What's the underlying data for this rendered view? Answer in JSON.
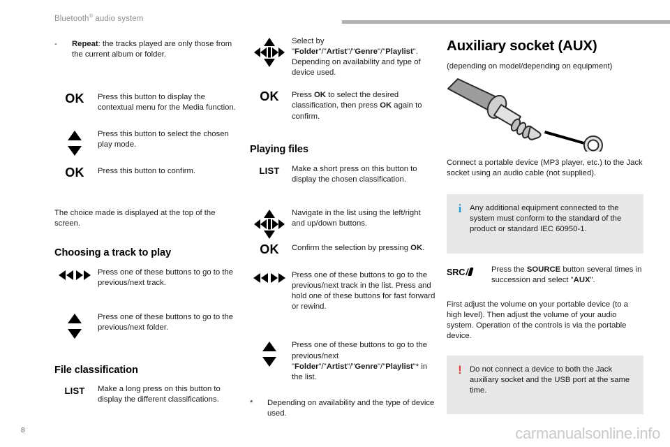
{
  "header": {
    "title_main": "Bluetooth",
    "title_sup": "®",
    "title_rest": " audio system"
  },
  "footer": {
    "page_number": "8",
    "watermark": "carmanualsonline.info"
  },
  "left_column": {
    "bullet": {
      "dash": "-",
      "bold_lead": "Repeat",
      "text": ": the tracks played are only those from the current album or folder."
    },
    "rows": [
      {
        "icon": "ok-button-label",
        "label": "OK",
        "text": "Press this button to display the contextual menu for the Media function."
      },
      {
        "icon": "up-down-arrows-icon",
        "label": "",
        "text": "Press this button to select the chosen play mode."
      },
      {
        "icon": "ok-button-label",
        "label": "OK",
        "text": "Press this button to confirm."
      }
    ],
    "note": "The choice made is displayed at the top of the screen.",
    "heading_track": "Choosing a track to play",
    "rows_track": [
      {
        "icon": "prev-next-arrows-icon",
        "label": "",
        "text": "Press one of these buttons to go to the previous/next track."
      },
      {
        "icon": "up-down-arrows-icon",
        "label": "",
        "text": "Press one of these buttons to go to the previous/next folder."
      }
    ],
    "heading_classification": "File classification",
    "row_list": {
      "icon": "list-button-label",
      "label": "LIST",
      "text": "Make a long press on this button to display the different classifications."
    }
  },
  "middle_column": {
    "row_select": {
      "icon": "four-way-navigation-icon",
      "line1_lead": "Select by \"",
      "opt1": "Folder",
      "opt2": "Artist",
      "opt3": "Genre",
      "opt4": "Playlist",
      "line1_tail": "\".",
      "line2": "Depending on availability and type of device used."
    },
    "row_ok": {
      "icon": "ok-button-label",
      "label": "OK",
      "t1": "Press ",
      "b1": "OK",
      "t2": " to select the desired classification, then press ",
      "b2": "OK",
      "t3": " again to confirm."
    },
    "heading_playing": "Playing files",
    "row_list": {
      "icon": "list-button-label",
      "label": "LIST",
      "text": "Make a short press on this button to display the chosen classification."
    },
    "row_navigate": {
      "icon": "four-way-navigation-icon",
      "text": "Navigate in the list using the left/right and up/down buttons."
    },
    "row_confirm": {
      "icon": "ok-button-label",
      "label": "OK",
      "t1": "Confirm the selection by pressing ",
      "b1": "OK",
      "t2": "."
    },
    "row_prevnext": {
      "icon": "prev-next-arrows-icon",
      "text": "Press one of these buttons to go to the previous/next track in the list. Press and hold one of these buttons for fast forward or rewind."
    },
    "row_folder": {
      "icon": "up-down-arrows-icon",
      "t1": "Press one of these buttons to go to the previous/next \"",
      "b1": "Folder",
      "t2": "\"/\"",
      "b2": "Artist",
      "t3": "\"/\"",
      "b3": "Genre",
      "t4": "\"/\"",
      "b4": "Playlist",
      "t5": "\"* in the list."
    },
    "footnote": {
      "star": "*",
      "text": "Depending on availability and the type of device used."
    }
  },
  "right_column": {
    "heading": "Auxiliary socket (AUX)",
    "subtitle": "(depending on model/depending on equipment)",
    "figure_name": "aux-jack-plug-illustration",
    "intro": "Connect a portable device (MP3 player, etc.) to the Jack socket using an audio cable (not supplied).",
    "info_box": {
      "icon": "info-icon",
      "glyph": "i",
      "text": "Any additional equipment connected to the system must conform to the standard of the product or standard IEC 60950-1."
    },
    "row_src": {
      "icon": "source-button-label",
      "label": "SRC",
      "t1": "Press the ",
      "b1": "SOURCE",
      "t2": " button several times in succession and select \"",
      "b2": "AUX",
      "t3": "\"."
    },
    "volume_note": "First adjust the volume on your portable device (to a high level). Then adjust the volume of your audio system. Operation of the controls is via the portable device.",
    "warning_box": {
      "icon": "warning-icon",
      "glyph": "!",
      "text": "Do not connect a device to both the Jack auxiliary socket and the USB port at the same time."
    }
  },
  "colors": {
    "info_blue": "#1b9ad1",
    "warning_red": "#ee3b33",
    "callout_bg": "#e8e8e8",
    "header_rule": "#b0b0b0",
    "header_text": "#8f8f8f",
    "watermark": "#c9c9c9"
  }
}
